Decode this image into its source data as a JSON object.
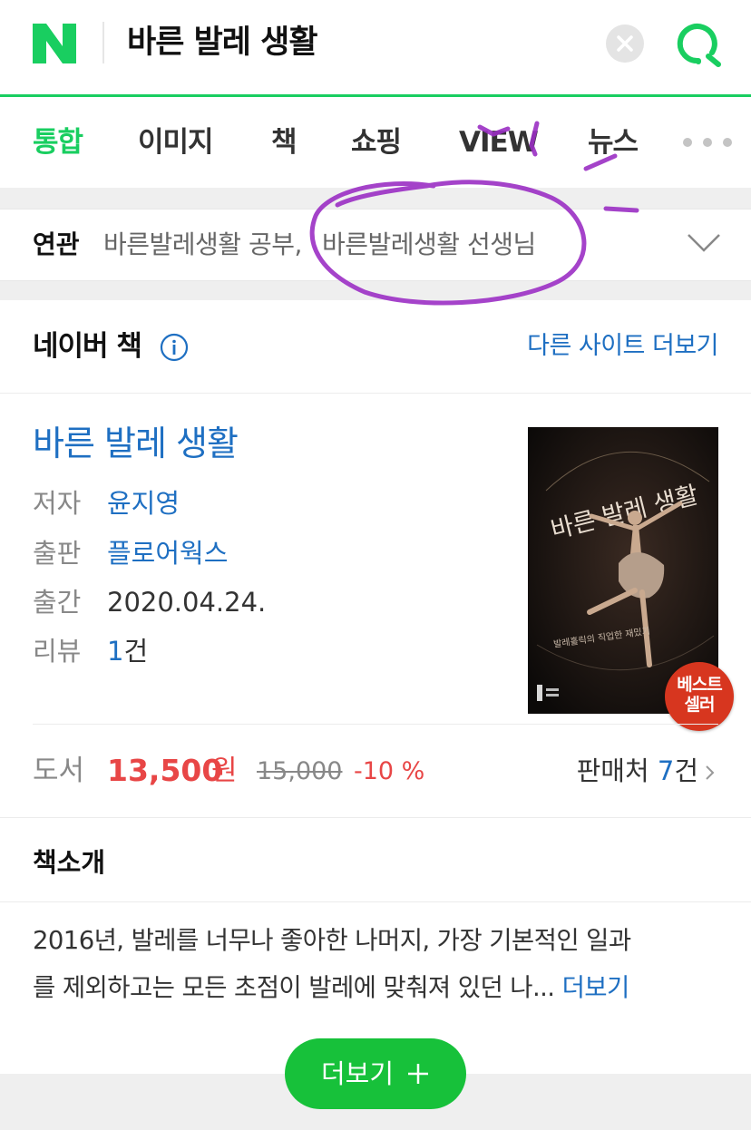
{
  "header": {
    "logo_letter": "N",
    "search_query": "바른 발레 생활"
  },
  "tabs": [
    {
      "label": "통합",
      "active": true
    },
    {
      "label": "이미지",
      "active": false
    },
    {
      "label": "책",
      "active": false
    },
    {
      "label": "쇼핑",
      "active": false
    },
    {
      "label": "VIEW",
      "active": false
    },
    {
      "label": "뉴스",
      "active": false
    }
  ],
  "related": {
    "label": "연관",
    "items": [
      "바른발레생활 공부,",
      "바른발레생활 선생님"
    ]
  },
  "book_card": {
    "section_title": "네이버 책",
    "other_sites_label": "다른 사이트 더보기",
    "title": "바른 발레 생활",
    "author_label": "저자",
    "author": "윤지영",
    "publisher_label": "출판",
    "publisher": "플로어웍스",
    "date_label": "출간",
    "date": "2020.04.24.",
    "review_label": "리뷰",
    "review_count": "1",
    "review_unit": "건",
    "cover": {
      "title_text": "바른 발레 생활",
      "subtitle_text": "발레홀릭의 직업한 재밌기"
    },
    "badge_line1": "베스트",
    "badge_line2": "셀러"
  },
  "price": {
    "label": "도서",
    "sale_price": "13,500",
    "unit": "원",
    "original_price": "15,000",
    "discount": "-10 %",
    "sellers_label": "판매처",
    "sellers_count": "7",
    "sellers_unit": "건"
  },
  "intro": {
    "title": "책소개",
    "line1": "2016년, 발레를 너무나 좋아한 나머지, 가장 기본적인 일과",
    "line2": "를 제외하고는 모든 초점이 발레에 맞춰져 있던 나...",
    "more_label": "더보기"
  },
  "more_button_label": "더보기",
  "colors": {
    "naver_green": "#19ce60",
    "button_green": "#17c13a",
    "link_blue": "#1e6fc2",
    "price_red": "#e84646",
    "annotation_purple": "#9b2fc4",
    "badge_red": "#d7361f"
  }
}
